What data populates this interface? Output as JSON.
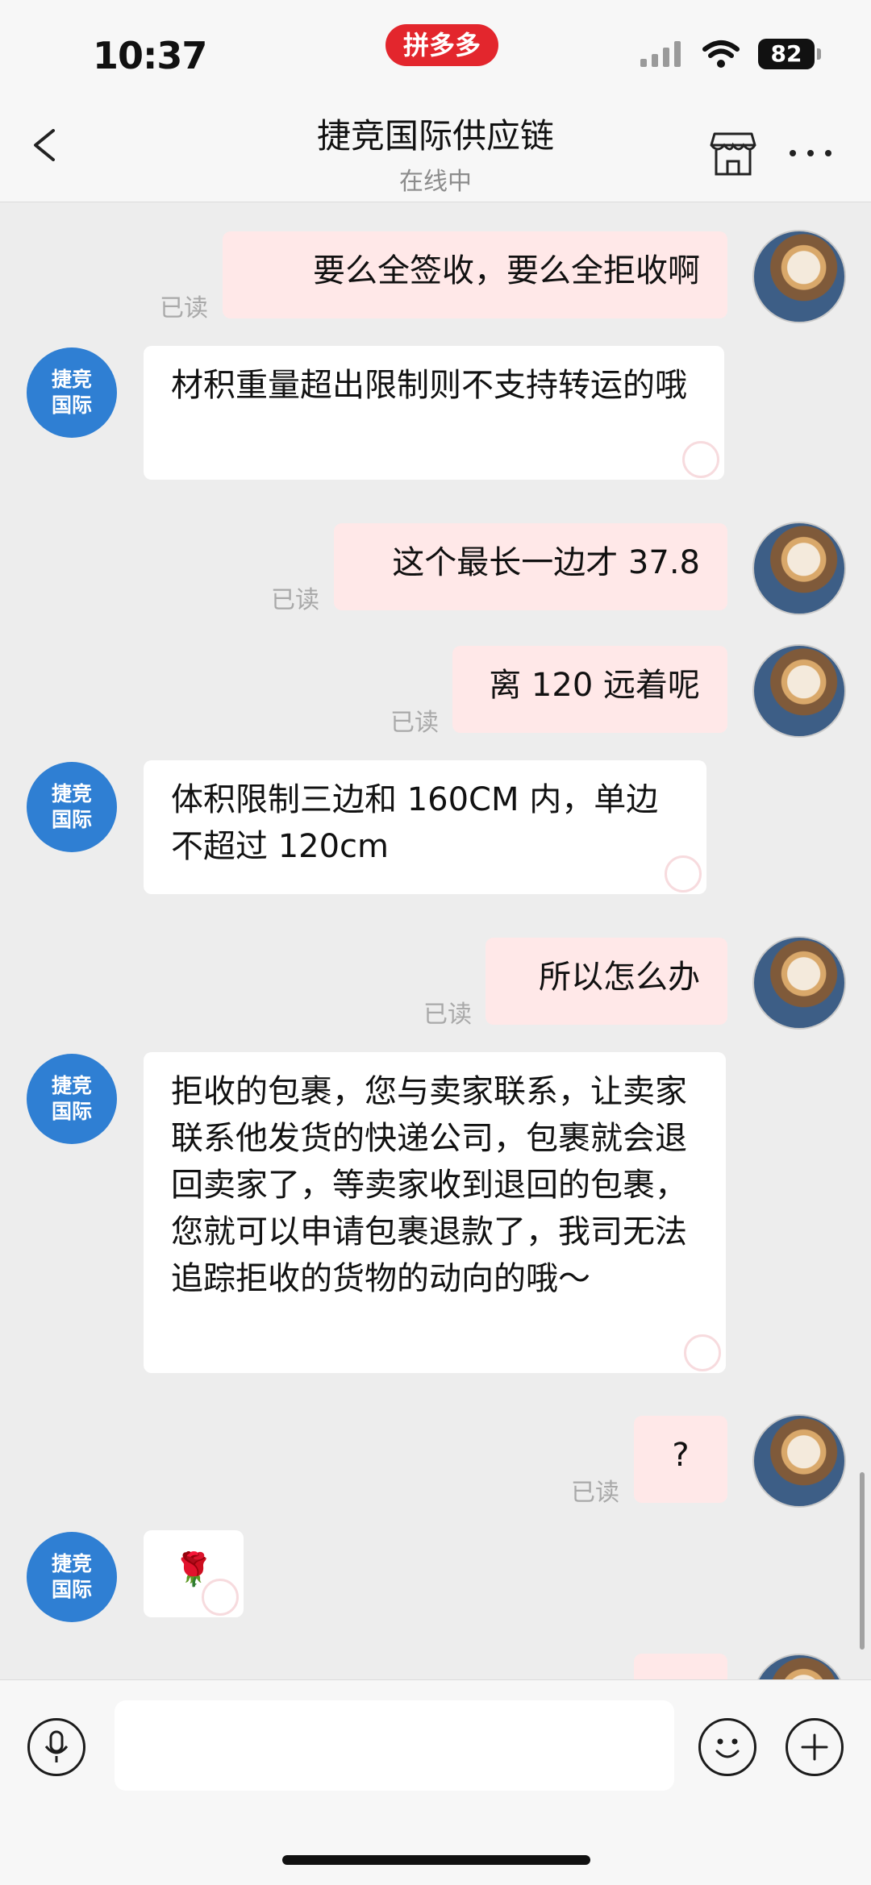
{
  "status": {
    "time": "10:37",
    "app_badge": "拼多多",
    "battery": "82"
  },
  "header": {
    "title": "捷竞国际供应链",
    "subtitle": "在线中"
  },
  "contact": {
    "avatar_text_line1": "捷竞",
    "avatar_text_line2": "国际"
  },
  "messages": [
    {
      "side": "me",
      "text": "要么全签收，要么全拒收啊",
      "read": "已读"
    },
    {
      "side": "them",
      "text": "材积重量超出限制则不支持转运的哦"
    },
    {
      "side": "me",
      "text": "这个最长一边才 37.8",
      "read": "已读"
    },
    {
      "side": "me",
      "text": "离 120 远着呢",
      "read": "已读"
    },
    {
      "side": "them",
      "text": "体积限制三边和 160CM 内，单边不超过 120cm"
    },
    {
      "side": "me",
      "text": "所以怎么办",
      "read": "已读"
    },
    {
      "side": "them",
      "text": "拒收的包裹，您与卖家联系，让卖家联系他发货的快递公司，包裹就会退回卖家了，等卖家收到退回的包裹，您就可以申请包裹退款了，我司无法追踪拒收的货物的动向的哦～"
    },
    {
      "side": "me",
      "text": "?",
      "read": "已读"
    },
    {
      "side": "them",
      "text": "🌹"
    }
  ],
  "input": {
    "placeholder": ""
  },
  "colors": {
    "accent": "#e3262d",
    "me_bubble": "#ffe8e8",
    "contact_avatar": "#2f7fd3"
  }
}
